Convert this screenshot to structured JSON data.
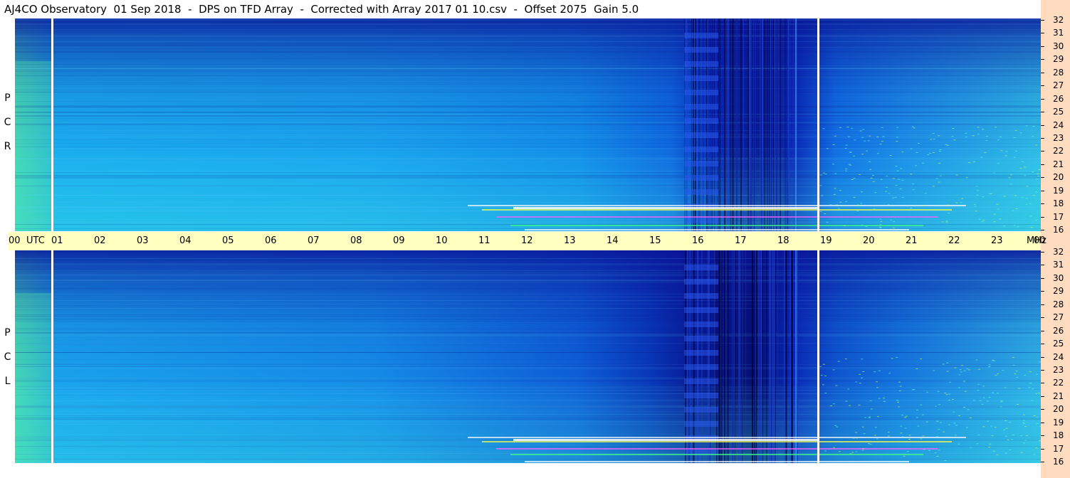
{
  "title": "AJ4CO Observatory  01 Sep 2018  -  DPS on TFD Array  -  Corrected with Array 2017 01 10.csv  -  Offset 2075  Gain 5.0",
  "panels": [
    {
      "id": "rcp",
      "letters": [
        "R",
        "C",
        "P"
      ]
    },
    {
      "id": "lcp",
      "letters": [
        "L",
        "C",
        "P"
      ]
    }
  ],
  "time_axis": {
    "ticks": [
      "00",
      "01",
      "02",
      "03",
      "04",
      "05",
      "06",
      "07",
      "08",
      "09",
      "10",
      "11",
      "12",
      "13",
      "14",
      "15",
      "16",
      "17",
      "18",
      "19",
      "20",
      "21",
      "22",
      "23",
      "00"
    ],
    "utc_label": "UTC",
    "unit_label": "MHz"
  },
  "freq_axis": {
    "ticks": [
      "32",
      "31",
      "30",
      "29",
      "28",
      "27",
      "26",
      "25",
      "24",
      "23",
      "22",
      "21",
      "20",
      "19",
      "18",
      "17",
      "16"
    ]
  },
  "colors": {
    "background_low": "#0a1fd0",
    "background_mid": "#1a8ee8",
    "background_high": "#40e0e0",
    "hot": "#e8ff40",
    "axis_band": "#ffffc0",
    "freq_band": "#ffdcc0"
  },
  "chart_data": {
    "type": "heatmap",
    "title": "AJ4CO Observatory  01 Sep 2018  -  DPS on TFD Array  -  Corrected with Array 2017 01 10.csv  -  Offset 2075  Gain 5.0",
    "xlabel": "UTC",
    "ylabel": "MHz",
    "x_range": [
      "00",
      "00"
    ],
    "ylim": [
      16,
      32
    ],
    "panels": [
      "RCP",
      "LCP"
    ],
    "grid": false
  }
}
